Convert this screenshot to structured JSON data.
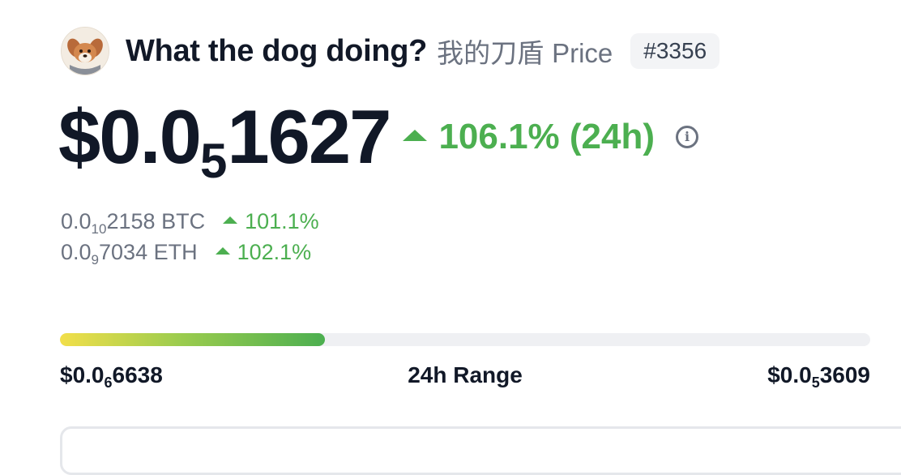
{
  "header": {
    "icon": "dog-avatar-icon",
    "coin_name": "What the dog doing?",
    "coin_symbol": "我的刀盾",
    "price_word": "Price",
    "rank": "#3356"
  },
  "price": {
    "prefix": "$0.0",
    "subscript_zeros": "5",
    "digits": "1627",
    "change_24h": "106.1% (24h)",
    "change_direction": "up"
  },
  "sub_prices": [
    {
      "prefix": "0.0",
      "zeros": "10",
      "digits": "2158",
      "unit": "BTC",
      "change": "101.1%"
    },
    {
      "prefix": "0.0",
      "zeros": "9",
      "digits": "7034",
      "unit": "ETH",
      "change": "102.1%"
    }
  ],
  "range_24h": {
    "title": "24h Range",
    "low": {
      "prefix": "$0.0",
      "zeros": "6",
      "digits": "6638"
    },
    "high": {
      "prefix": "$0.0",
      "zeros": "5",
      "digits": "3609"
    },
    "position_fraction": 0.327
  },
  "colors": {
    "positive": "#4caf50",
    "muted_text": "#6b7280",
    "primary_text": "#111827",
    "range_gradient_start": "#f2df4a",
    "range_gradient_end": "#4caf50",
    "track": "#eff0f3"
  }
}
